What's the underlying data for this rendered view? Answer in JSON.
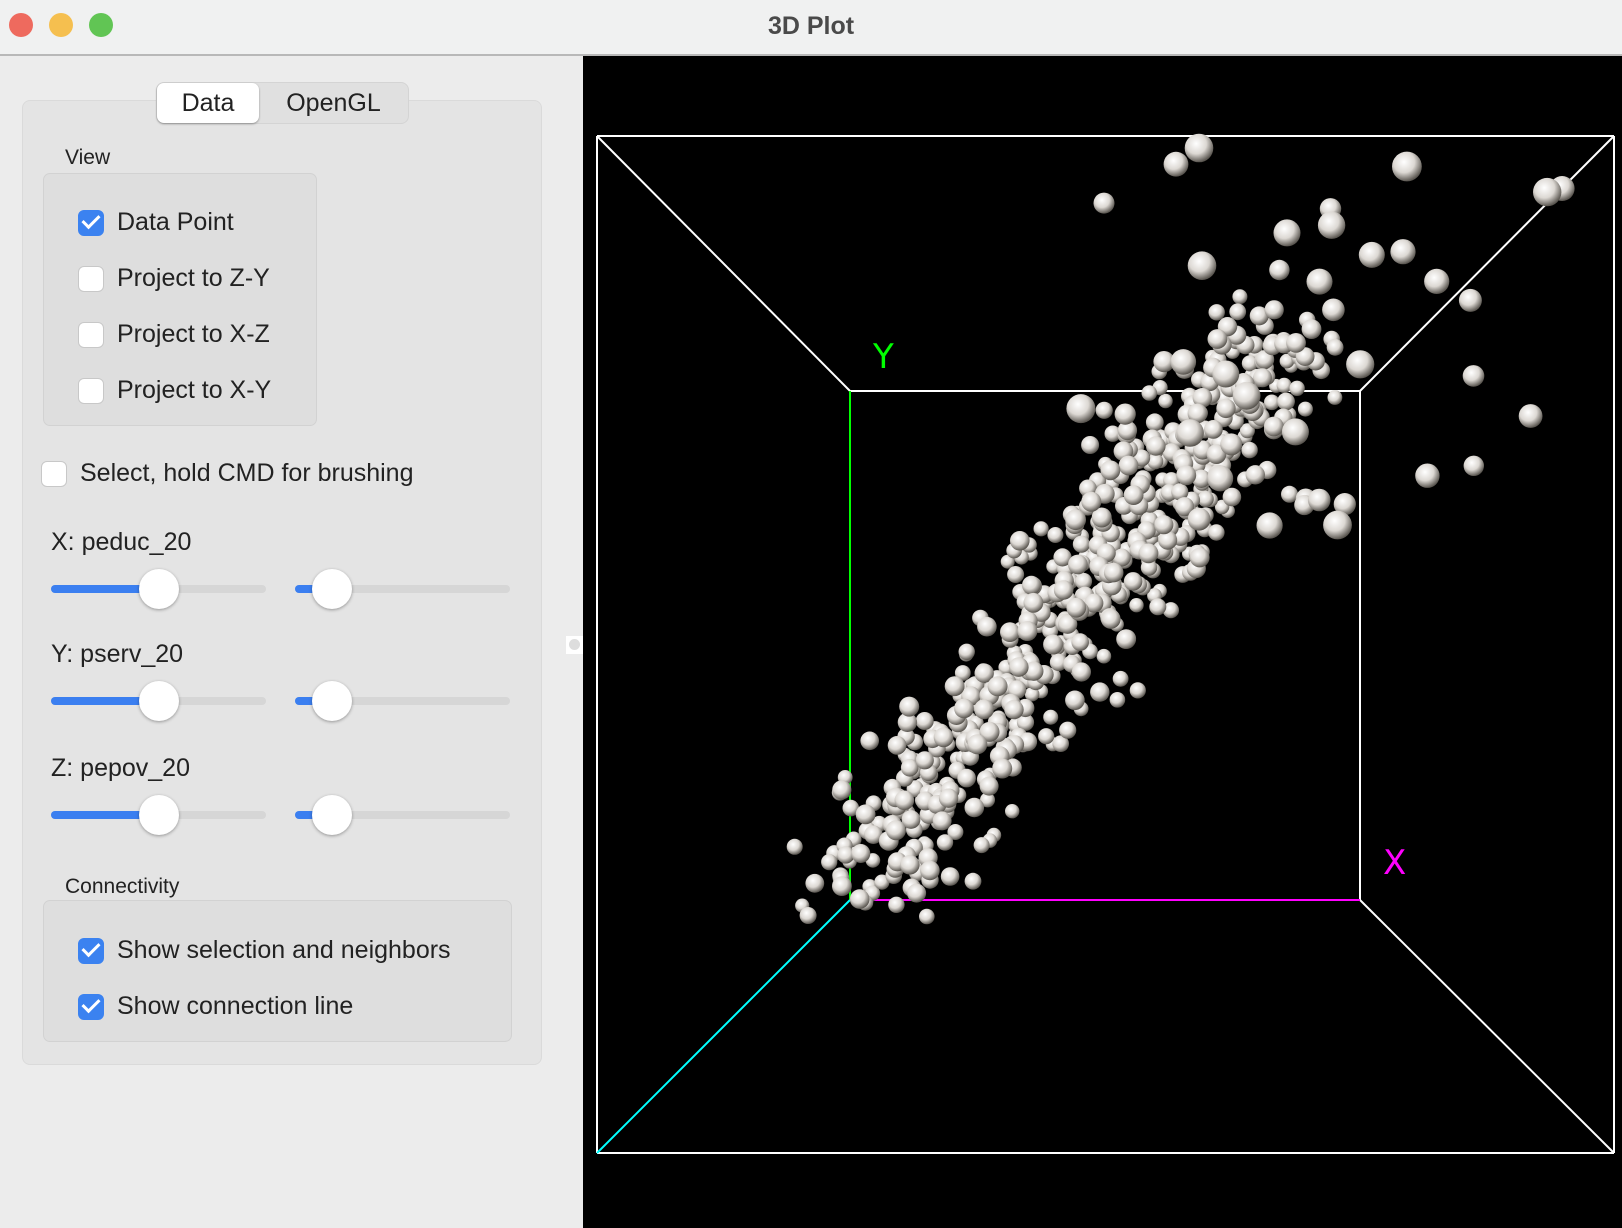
{
  "window": {
    "title": "3D Plot",
    "traffic_lights": {
      "close": "#ee6a5e",
      "minimize": "#f5bf4f",
      "zoom": "#61c554"
    }
  },
  "tabs": [
    {
      "label": "Data",
      "active": true
    },
    {
      "label": "OpenGL",
      "active": false
    }
  ],
  "view": {
    "label": "View",
    "options": [
      {
        "label": "Data Point",
        "checked": true
      },
      {
        "label": "Project to Z-Y",
        "checked": false
      },
      {
        "label": "Project to X-Z",
        "checked": false
      },
      {
        "label": "Project to X-Y",
        "checked": false
      }
    ]
  },
  "select": {
    "label": "Select, hold CMD for brushing",
    "checked": false
  },
  "axes": [
    {
      "label": "X: peduc_20",
      "slider1": 0.5,
      "slider2": 0.17
    },
    {
      "label": "Y: pserv_20",
      "slider1": 0.5,
      "slider2": 0.17
    },
    {
      "label": "Z: pepov_20",
      "slider1": 0.5,
      "slider2": 0.17
    }
  ],
  "connectivity": {
    "label": "Connectivity",
    "options": [
      {
        "label": "Show selection and neighbors",
        "checked": true
      },
      {
        "label": "Show connection line",
        "checked": true
      }
    ]
  },
  "plot": {
    "x_axis_label": "X",
    "y_axis_label": "Y",
    "colors": {
      "x_axis": "#ff00ff",
      "y_axis": "#00ff00",
      "z_axis": "#00ffff",
      "box": "#ffffff",
      "background": "#000000",
      "accent": "#3b7ff0"
    }
  }
}
